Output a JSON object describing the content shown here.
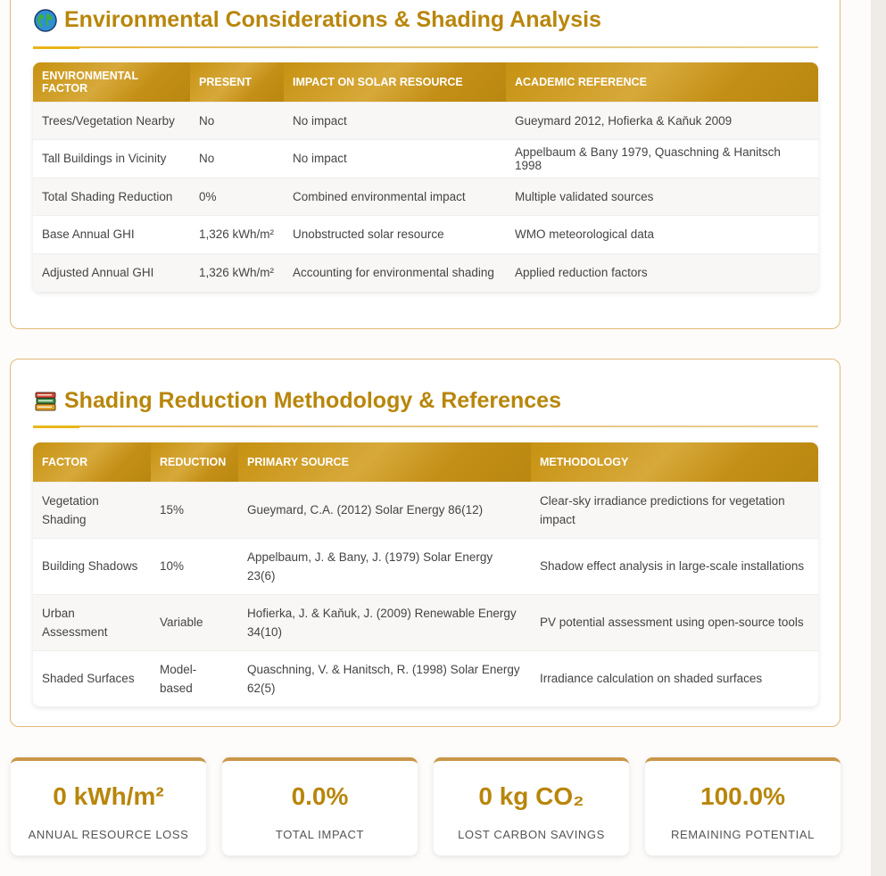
{
  "env_section": {
    "title": "Environmental Considerations & Shading Analysis",
    "icon": "globe-icon",
    "headers": [
      "Environmental Factor",
      "Present",
      "Impact on Solar Resource",
      "Academic Reference"
    ],
    "rows": [
      [
        "Trees/Vegetation Nearby",
        "No",
        "No impact",
        "Gueymard 2012, Hofierka & Kaňuk 2009"
      ],
      [
        "Tall Buildings in Vicinity",
        "No",
        "No impact",
        "Appelbaum & Bany 1979, Quaschning & Hanitsch 1998"
      ],
      [
        "Total Shading Reduction",
        "0%",
        "Combined environmental impact",
        "Multiple validated sources"
      ],
      [
        "Base Annual GHI",
        "1,326 kWh/m²",
        "Unobstructed solar resource",
        "WMO meteorological data"
      ],
      [
        "Adjusted Annual GHI",
        "1,326 kWh/m²",
        "Accounting for environmental shading",
        "Applied reduction factors"
      ]
    ]
  },
  "method_section": {
    "title": "Shading Reduction Methodology & References",
    "icon": "books-icon",
    "headers": [
      "Factor",
      "Reduction",
      "Primary Source",
      "Methodology"
    ],
    "rows": [
      [
        "Vegetation Shading",
        "15%",
        "Gueymard, C.A. (2012) Solar Energy 86(12)",
        "Clear-sky irradiance predictions for vegetation impact"
      ],
      [
        "Building Shadows",
        "10%",
        "Appelbaum, J. & Bany, J. (1979) Solar Energy 23(6)",
        "Shadow effect analysis in large-scale installations"
      ],
      [
        "Urban Assessment",
        "Variable",
        "Hofierka, J. & Kaňuk, J. (2009) Renewable Energy 34(10)",
        "PV potential assessment using open-source tools"
      ],
      [
        "Shaded Surfaces",
        "Model-based",
        "Quaschning, V. & Hanitsch, R. (1998) Solar Energy 62(5)",
        "Irradiance calculation on shaded surfaces"
      ]
    ]
  },
  "stats": [
    {
      "value": "0 kWh/m²",
      "label": "Annual Resource Loss"
    },
    {
      "value": "0.0%",
      "label": "Total Impact"
    },
    {
      "value": "0 kg CO₂",
      "label": "Lost Carbon Savings"
    },
    {
      "value": "100.0%",
      "label": "Remaining Potential"
    }
  ],
  "colors": {
    "accent": "#b8860b",
    "header_gradient": "#c79212",
    "card_border": "#e2b978"
  }
}
